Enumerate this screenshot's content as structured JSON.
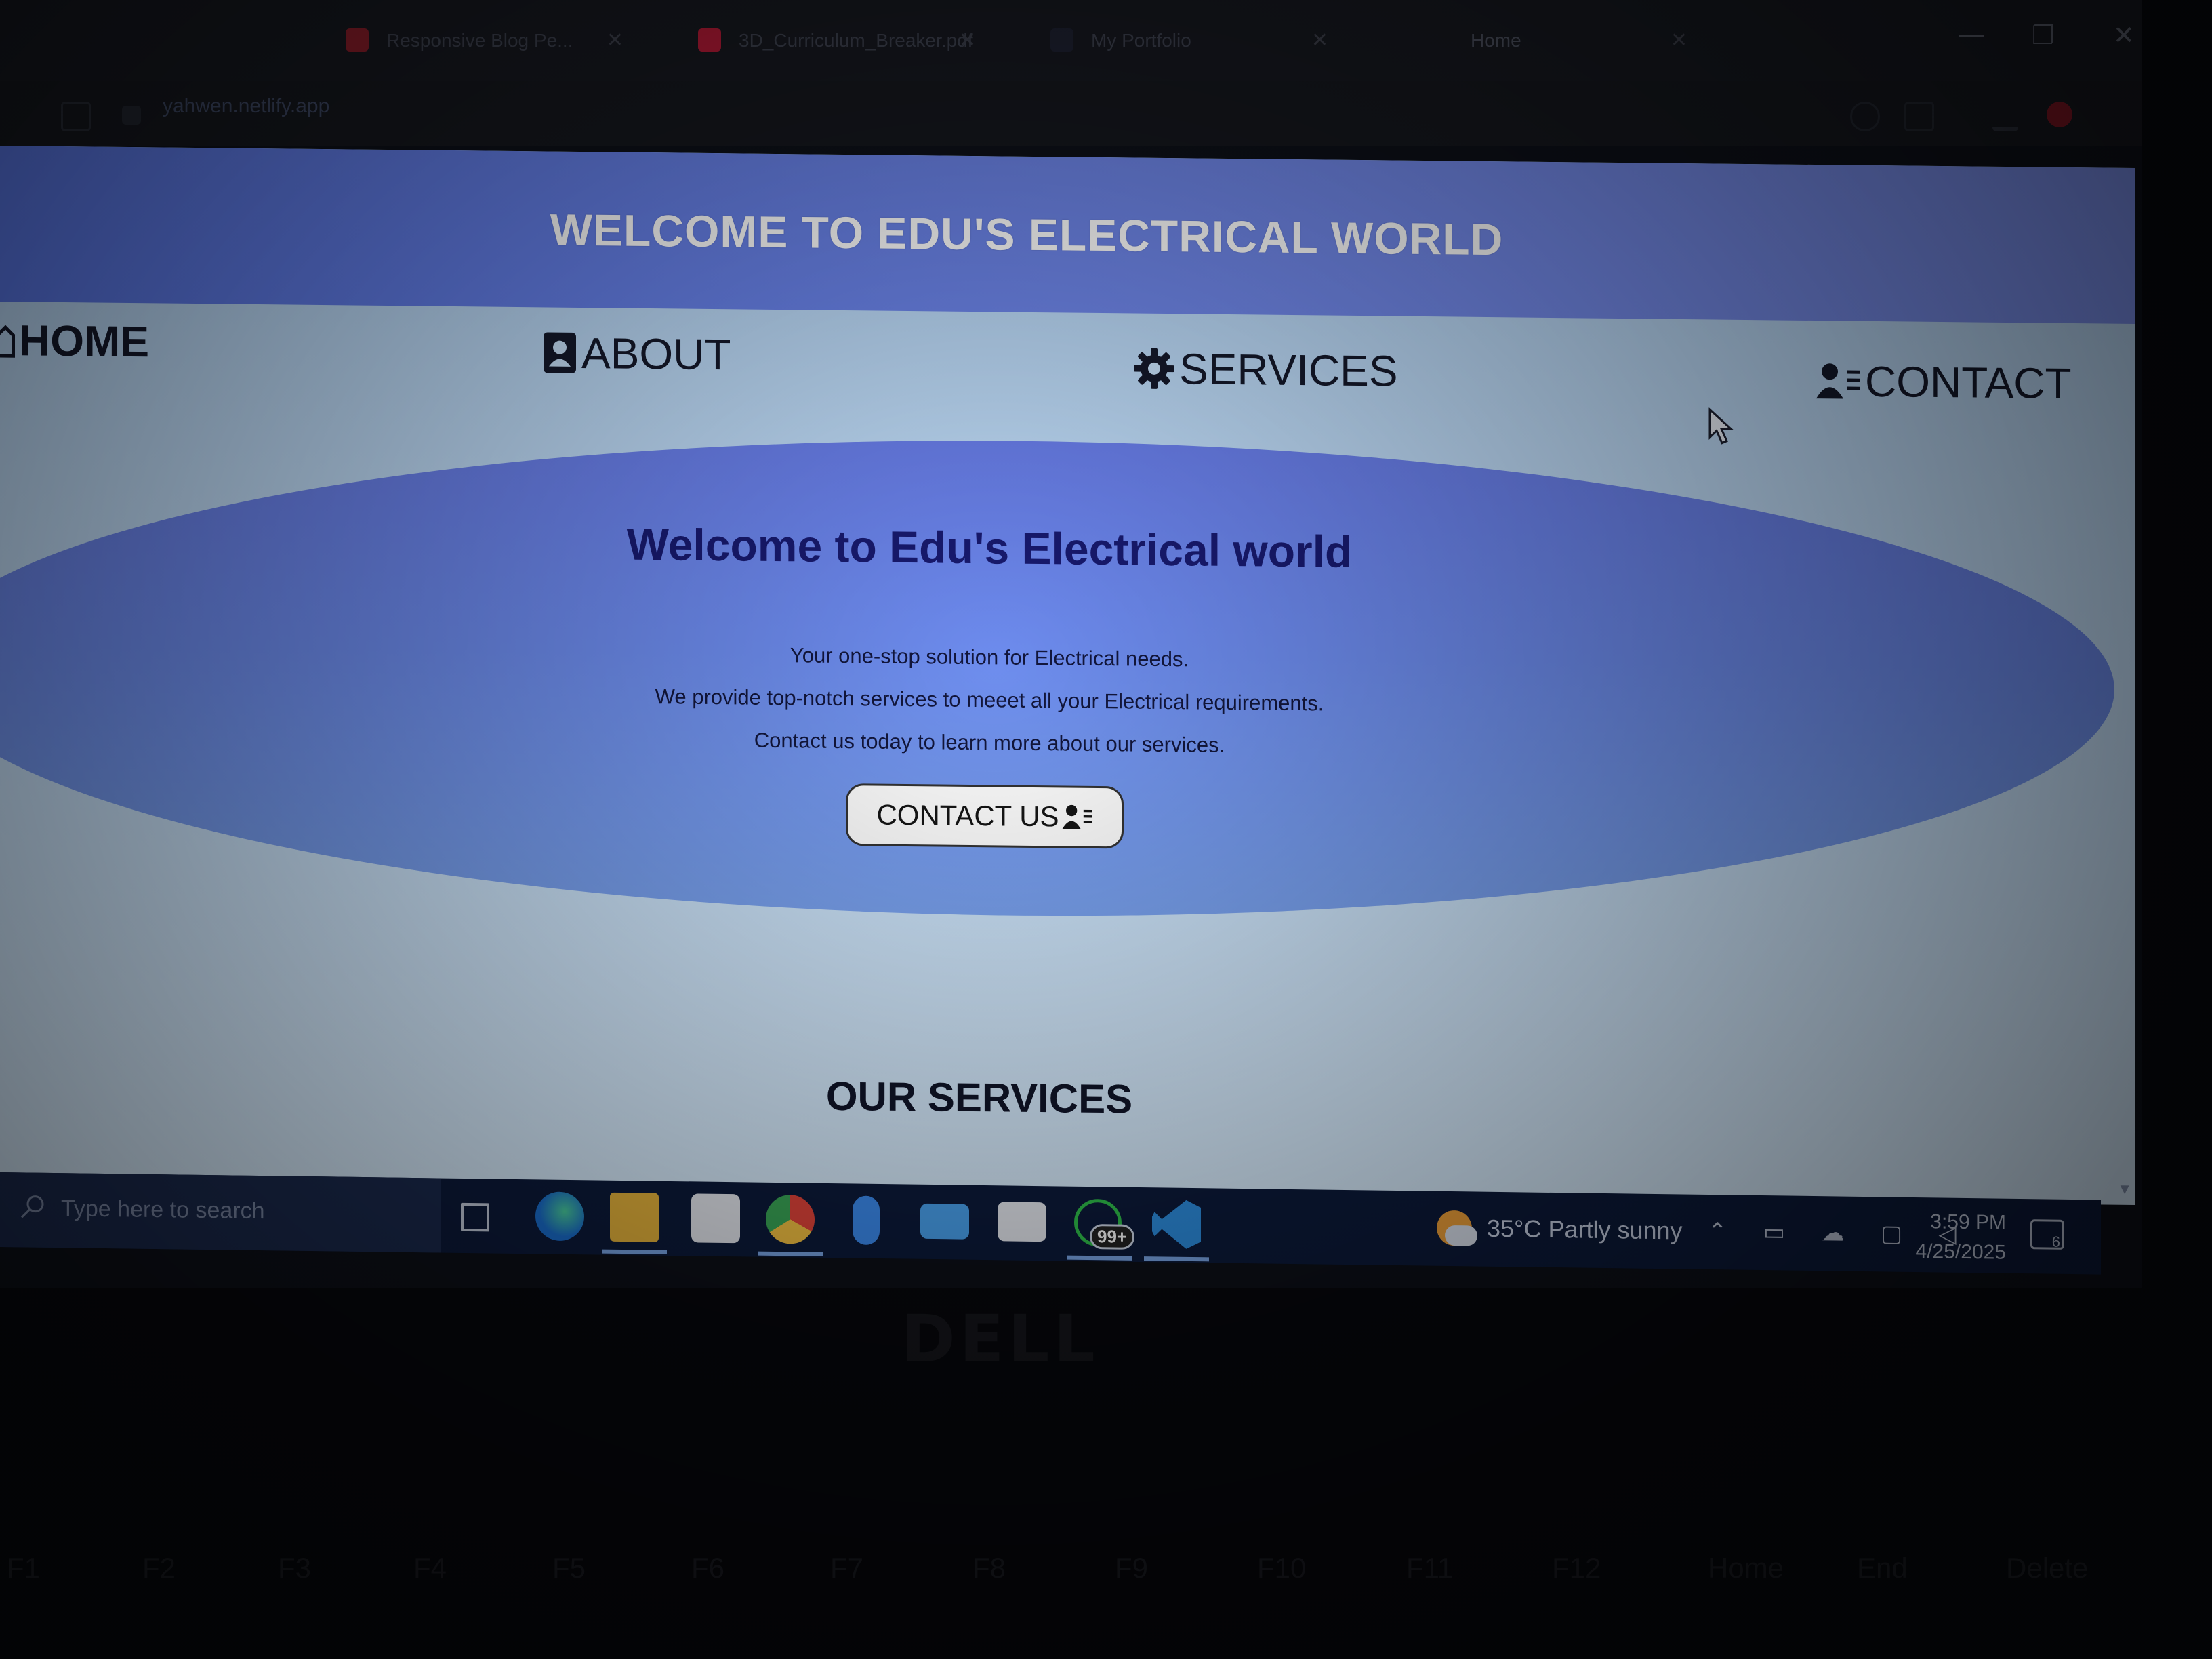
{
  "browser": {
    "tabs": [
      {
        "title": "Responsive Blog Pe...",
        "active": false
      },
      {
        "title": "3D_Curriculum_Breaker.pdf",
        "active": false
      },
      {
        "title": "My Portfolio",
        "active": false
      },
      {
        "title": "Home",
        "active": true
      }
    ],
    "url": "yahwen.netlify.app",
    "close_glyph": "✕",
    "minimize_glyph": "—",
    "restore_glyph": "❐"
  },
  "page": {
    "banner_title": "WELCOME TO EDU'S ELECTRICAL WORLD",
    "nav": [
      {
        "label": "HOME",
        "icon": "home-icon"
      },
      {
        "label": "ABOUT",
        "icon": "contact-card-icon"
      },
      {
        "label": "SERVICES",
        "icon": "gear-icon"
      },
      {
        "label": "CONTACT",
        "icon": "user-list-icon"
      }
    ],
    "hero": {
      "title": "Welcome to Edu's Electrical world",
      "lines": [
        "Your one-stop solution for Electrical needs.",
        "We provide top-notch services to meeet all your Electrical requirements.",
        "Contact us today to learn more about our services."
      ],
      "cta_label": "CONTACT US"
    },
    "section_title": "OUR SERVICES",
    "colors": {
      "banner": "#6a80ea",
      "hero": "#6d8cee",
      "background": "#c8e2fb",
      "title_text": "#181a70"
    }
  },
  "taskbar": {
    "search_placeholder": "Type here to search",
    "pinned": [
      "task-view-icon",
      "edge-icon",
      "file-explorer-icon",
      "store-icon",
      "chrome-icon",
      "bluetooth-icon",
      "mail-icon",
      "calendar-icon",
      "whatsapp-icon",
      "vscode-icon"
    ],
    "whatsapp_badge": "99+",
    "weather": "35°C  Partly sunny",
    "time": "3:59 PM",
    "date": "4/25/2025",
    "notification_count": "6"
  },
  "bezel": {
    "brand": "DELL"
  },
  "keyboard": {
    "keys": [
      "F1",
      "F2",
      "F3",
      "F4",
      "F5",
      "F6",
      "F7",
      "F8",
      "F9",
      "F10",
      "F11",
      "F12",
      "Home",
      "End",
      "Delete"
    ]
  }
}
